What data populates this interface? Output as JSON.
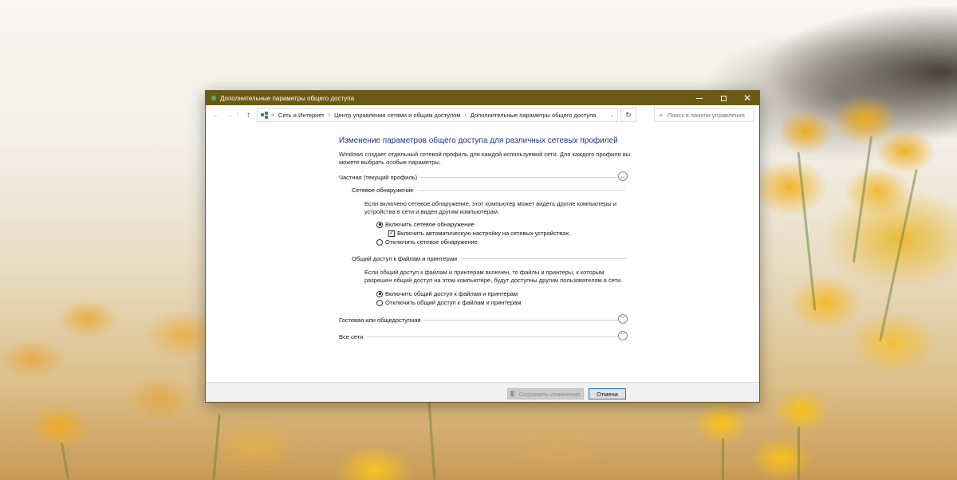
{
  "window": {
    "title": "Дополнительные параметры общего доступа",
    "accent": "#6b5a13"
  },
  "address": {
    "crumbs": [
      "Сеть и Интернет",
      "Центр управления сетями и общим доступом",
      "Дополнительные параметры общего доступа"
    ],
    "search_placeholder": "Поиск в панели управления"
  },
  "main": {
    "heading": "Изменение параметров общего доступа для различных сетевых профилей",
    "description": "Windows создает отдельный сетевой профиль для каждой используемой сети. Для каждого профиля вы можете выбрать особые параметры.",
    "profiles": [
      {
        "label": "Частная (текущий профиль)",
        "expanded": true,
        "sections": [
          {
            "label": "Сетевое обнаружение",
            "description": "Если включено сетевое обнаружение, этот компьютер может видеть другие компьютеры и устройства в сети и виден другим компьютерам.",
            "options": [
              {
                "label": "Включить сетевое обнаружение",
                "type": "radio",
                "selected": true
              },
              {
                "label": "Включить автоматическую настройку на сетевых устройствах.",
                "type": "checkbox",
                "checked": true
              },
              {
                "label": "Отключить сетевое обнаружение",
                "type": "radio",
                "selected": false
              }
            ]
          },
          {
            "label": "Общий доступ к файлам и принтерам",
            "description": "Если общий доступ к файлам и принтерам включен, то файлы и принтеры, к которым разрешен общий доступ на этом компьютере, будут доступны другим пользователям в сети.",
            "options": [
              {
                "label": "Включить общий доступ к файлам и принтерам",
                "type": "radio",
                "selected": true
              },
              {
                "label": "Отключить общий доступ к файлам и принтерам",
                "type": "radio",
                "selected": false
              }
            ]
          }
        ]
      },
      {
        "label": "Гостевая или общедоступная",
        "expanded": false
      },
      {
        "label": "Все сети",
        "expanded": false
      }
    ]
  },
  "footer": {
    "save_label": "Сохранить изменения",
    "cancel_label": "Отмена"
  }
}
